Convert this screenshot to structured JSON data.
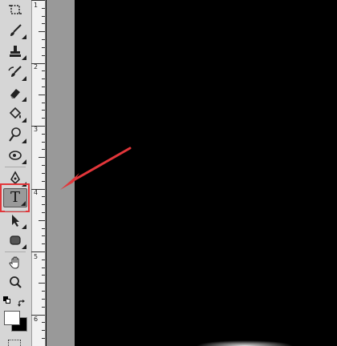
{
  "toolbar": {
    "tools": [
      {
        "name": "crop-tool",
        "icon": "crop-icon"
      },
      {
        "name": "brush-tool",
        "icon": "brush-icon"
      },
      {
        "name": "stamp-tool",
        "icon": "stamp-icon"
      },
      {
        "name": "history-brush-tool",
        "icon": "history-brush-icon"
      },
      {
        "name": "eraser-tool",
        "icon": "eraser-icon"
      },
      {
        "name": "paint-bucket-tool",
        "icon": "paint-bucket-icon"
      },
      {
        "name": "dodge-tool",
        "icon": "dodge-icon"
      },
      {
        "name": "smudge-tool",
        "icon": "smudge-icon"
      },
      {
        "name": "pen-tool",
        "icon": "pen-icon"
      },
      {
        "name": "type-tool",
        "icon": "type-icon",
        "glyph": "T",
        "selected": true
      },
      {
        "name": "path-selection-tool",
        "icon": "arrow-cursor-icon"
      },
      {
        "name": "rectangle-tool",
        "icon": "rounded-rectangle-icon"
      },
      {
        "name": "hand-tool",
        "icon": "hand-icon"
      },
      {
        "name": "zoom-tool",
        "icon": "magnifier-icon"
      }
    ],
    "foreground_color": "#ffffff",
    "background_color": "#000000",
    "highlight_color": "#e2363a"
  },
  "ruler": {
    "labels": [
      "1",
      "2",
      "3",
      "4",
      "5",
      "6"
    ]
  },
  "annotation": {
    "arrow_color": "#e2363a"
  }
}
